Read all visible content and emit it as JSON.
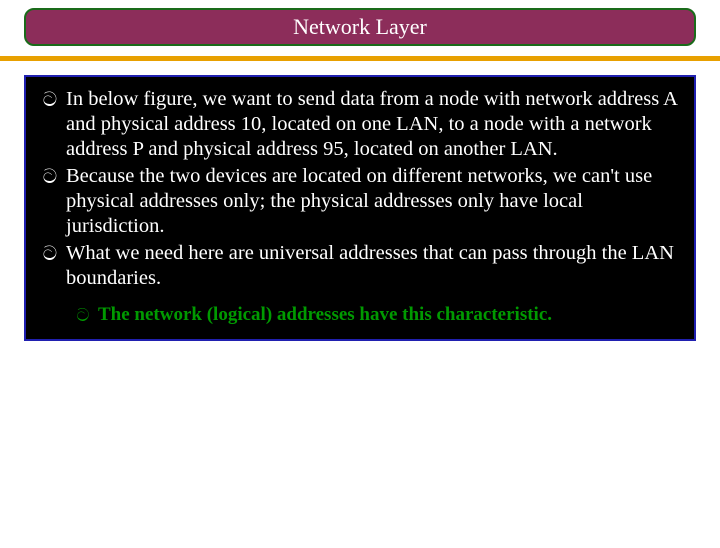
{
  "title": "Network Layer",
  "bullets": [
    "In below figure, we want to send data from a node with network address A and physical address 10, located on one LAN, to a node with a network address P and physical address 95, located on another LAN.",
    "Because the two devices are located on different networks, we can't use physical addresses only; the physical addresses only have local jurisdiction.",
    "What we need here are universal addresses that can pass through the LAN boundaries."
  ],
  "sub_bullet": "The network (logical) addresses have this characteristic.",
  "icons": {
    "main": "ට",
    "sub": "ට"
  }
}
